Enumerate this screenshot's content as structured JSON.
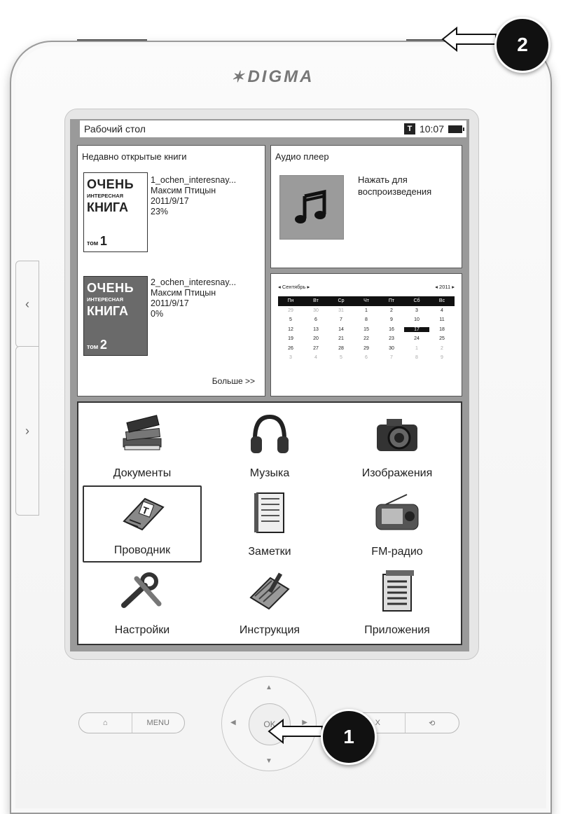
{
  "device": {
    "brand": "DIGMA"
  },
  "status_bar": {
    "title": "Рабочий стол",
    "time": "10:07",
    "t_icon": "T"
  },
  "recent_books": {
    "title": "Недавно открытые книги",
    "more_label": "Больше >>",
    "books": [
      {
        "filename": "1_ochen_interesnay...",
        "author": "Максим Птицын",
        "date": "2011/9/17",
        "progress": "23%",
        "cover": {
          "line1": "ОЧЕНЬ",
          "line2": "ИНТЕРЕСНАЯ",
          "line3": "КНИГА",
          "vol_prefix": "том",
          "vol": "1"
        }
      },
      {
        "filename": "2_ochen_interesnay...",
        "author": "Максим Птицын",
        "date": "2011/9/17",
        "progress": "0%",
        "cover": {
          "line1": "ОЧЕНЬ",
          "line2": "ИНТЕРЕСНАЯ",
          "line3": "КНИГА",
          "vol_prefix": "том",
          "vol": "2"
        }
      }
    ]
  },
  "audio_player": {
    "title": "Аудио плеер",
    "hint_line1": "Нажать для",
    "hint_line2": "воспроизведения"
  },
  "calendar": {
    "month": "◂ Сентябрь ▸",
    "year": "◂ 2011 ▸",
    "weekdays": [
      "Пн",
      "Вт",
      "Ср",
      "Чт",
      "Пт",
      "Сб",
      "Вс"
    ],
    "weeks": [
      [
        "29",
        "30",
        "31",
        "1",
        "2",
        "3",
        "4"
      ],
      [
        "5",
        "6",
        "7",
        "8",
        "9",
        "10",
        "11"
      ],
      [
        "12",
        "13",
        "14",
        "15",
        "16",
        "17",
        "18"
      ],
      [
        "19",
        "20",
        "21",
        "22",
        "23",
        "24",
        "25"
      ],
      [
        "26",
        "27",
        "28",
        "29",
        "30",
        "1",
        "2"
      ],
      [
        "3",
        "4",
        "5",
        "6",
        "7",
        "8",
        "9"
      ]
    ],
    "selected_day": "17"
  },
  "apps": [
    {
      "label": "Документы",
      "icon": "books-icon"
    },
    {
      "label": "Музыка",
      "icon": "headphones-icon"
    },
    {
      "label": "Изображения",
      "icon": "camera-icon"
    },
    {
      "label": "Проводник",
      "icon": "memory-card-icon",
      "selected": true
    },
    {
      "label": "Заметки",
      "icon": "notebook-icon"
    },
    {
      "label": "FM-радио",
      "icon": "radio-icon"
    },
    {
      "label": "Настройки",
      "icon": "tools-icon"
    },
    {
      "label": "Инструкция",
      "icon": "manual-icon"
    },
    {
      "label": "Приложения",
      "icon": "apps-icon"
    }
  ],
  "hardware": {
    "home_icon": "home-icon",
    "menu_label": "MENU",
    "ok_label": "OK",
    "back_label": "X",
    "rotate_icon": "rotate-icon"
  },
  "callouts": [
    {
      "number": "1"
    },
    {
      "number": "2"
    }
  ]
}
